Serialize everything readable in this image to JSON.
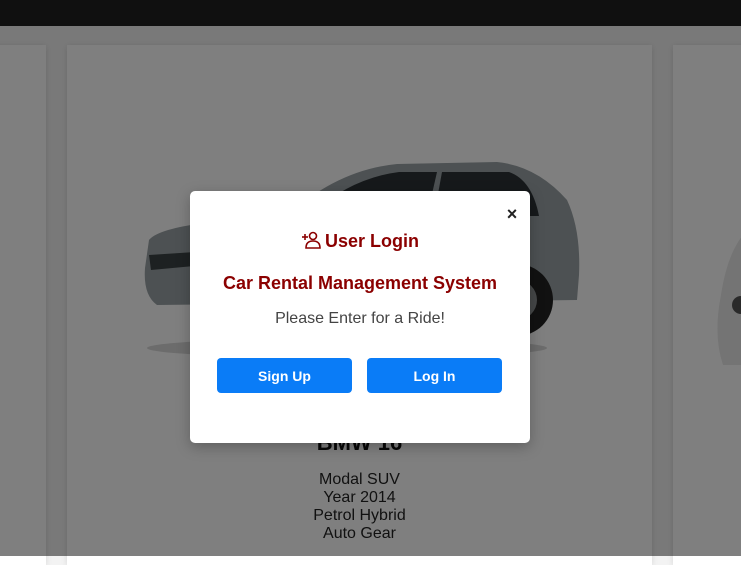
{
  "car": {
    "name": "BMW 16",
    "specs": [
      "Modal SUV",
      "Year 2014",
      "Petrol Hybrid",
      "Auto Gear"
    ]
  },
  "modal": {
    "close_label": "×",
    "title": "User Login",
    "subtitle": "Car Rental Management System",
    "message": "Please Enter for a Ride!",
    "signup_label": "Sign Up",
    "login_label": "Log In",
    "icon": "user-plus-icon"
  },
  "colors": {
    "accent": "#8b0000",
    "button": "#0a7cf7",
    "topbar": "#212121"
  }
}
